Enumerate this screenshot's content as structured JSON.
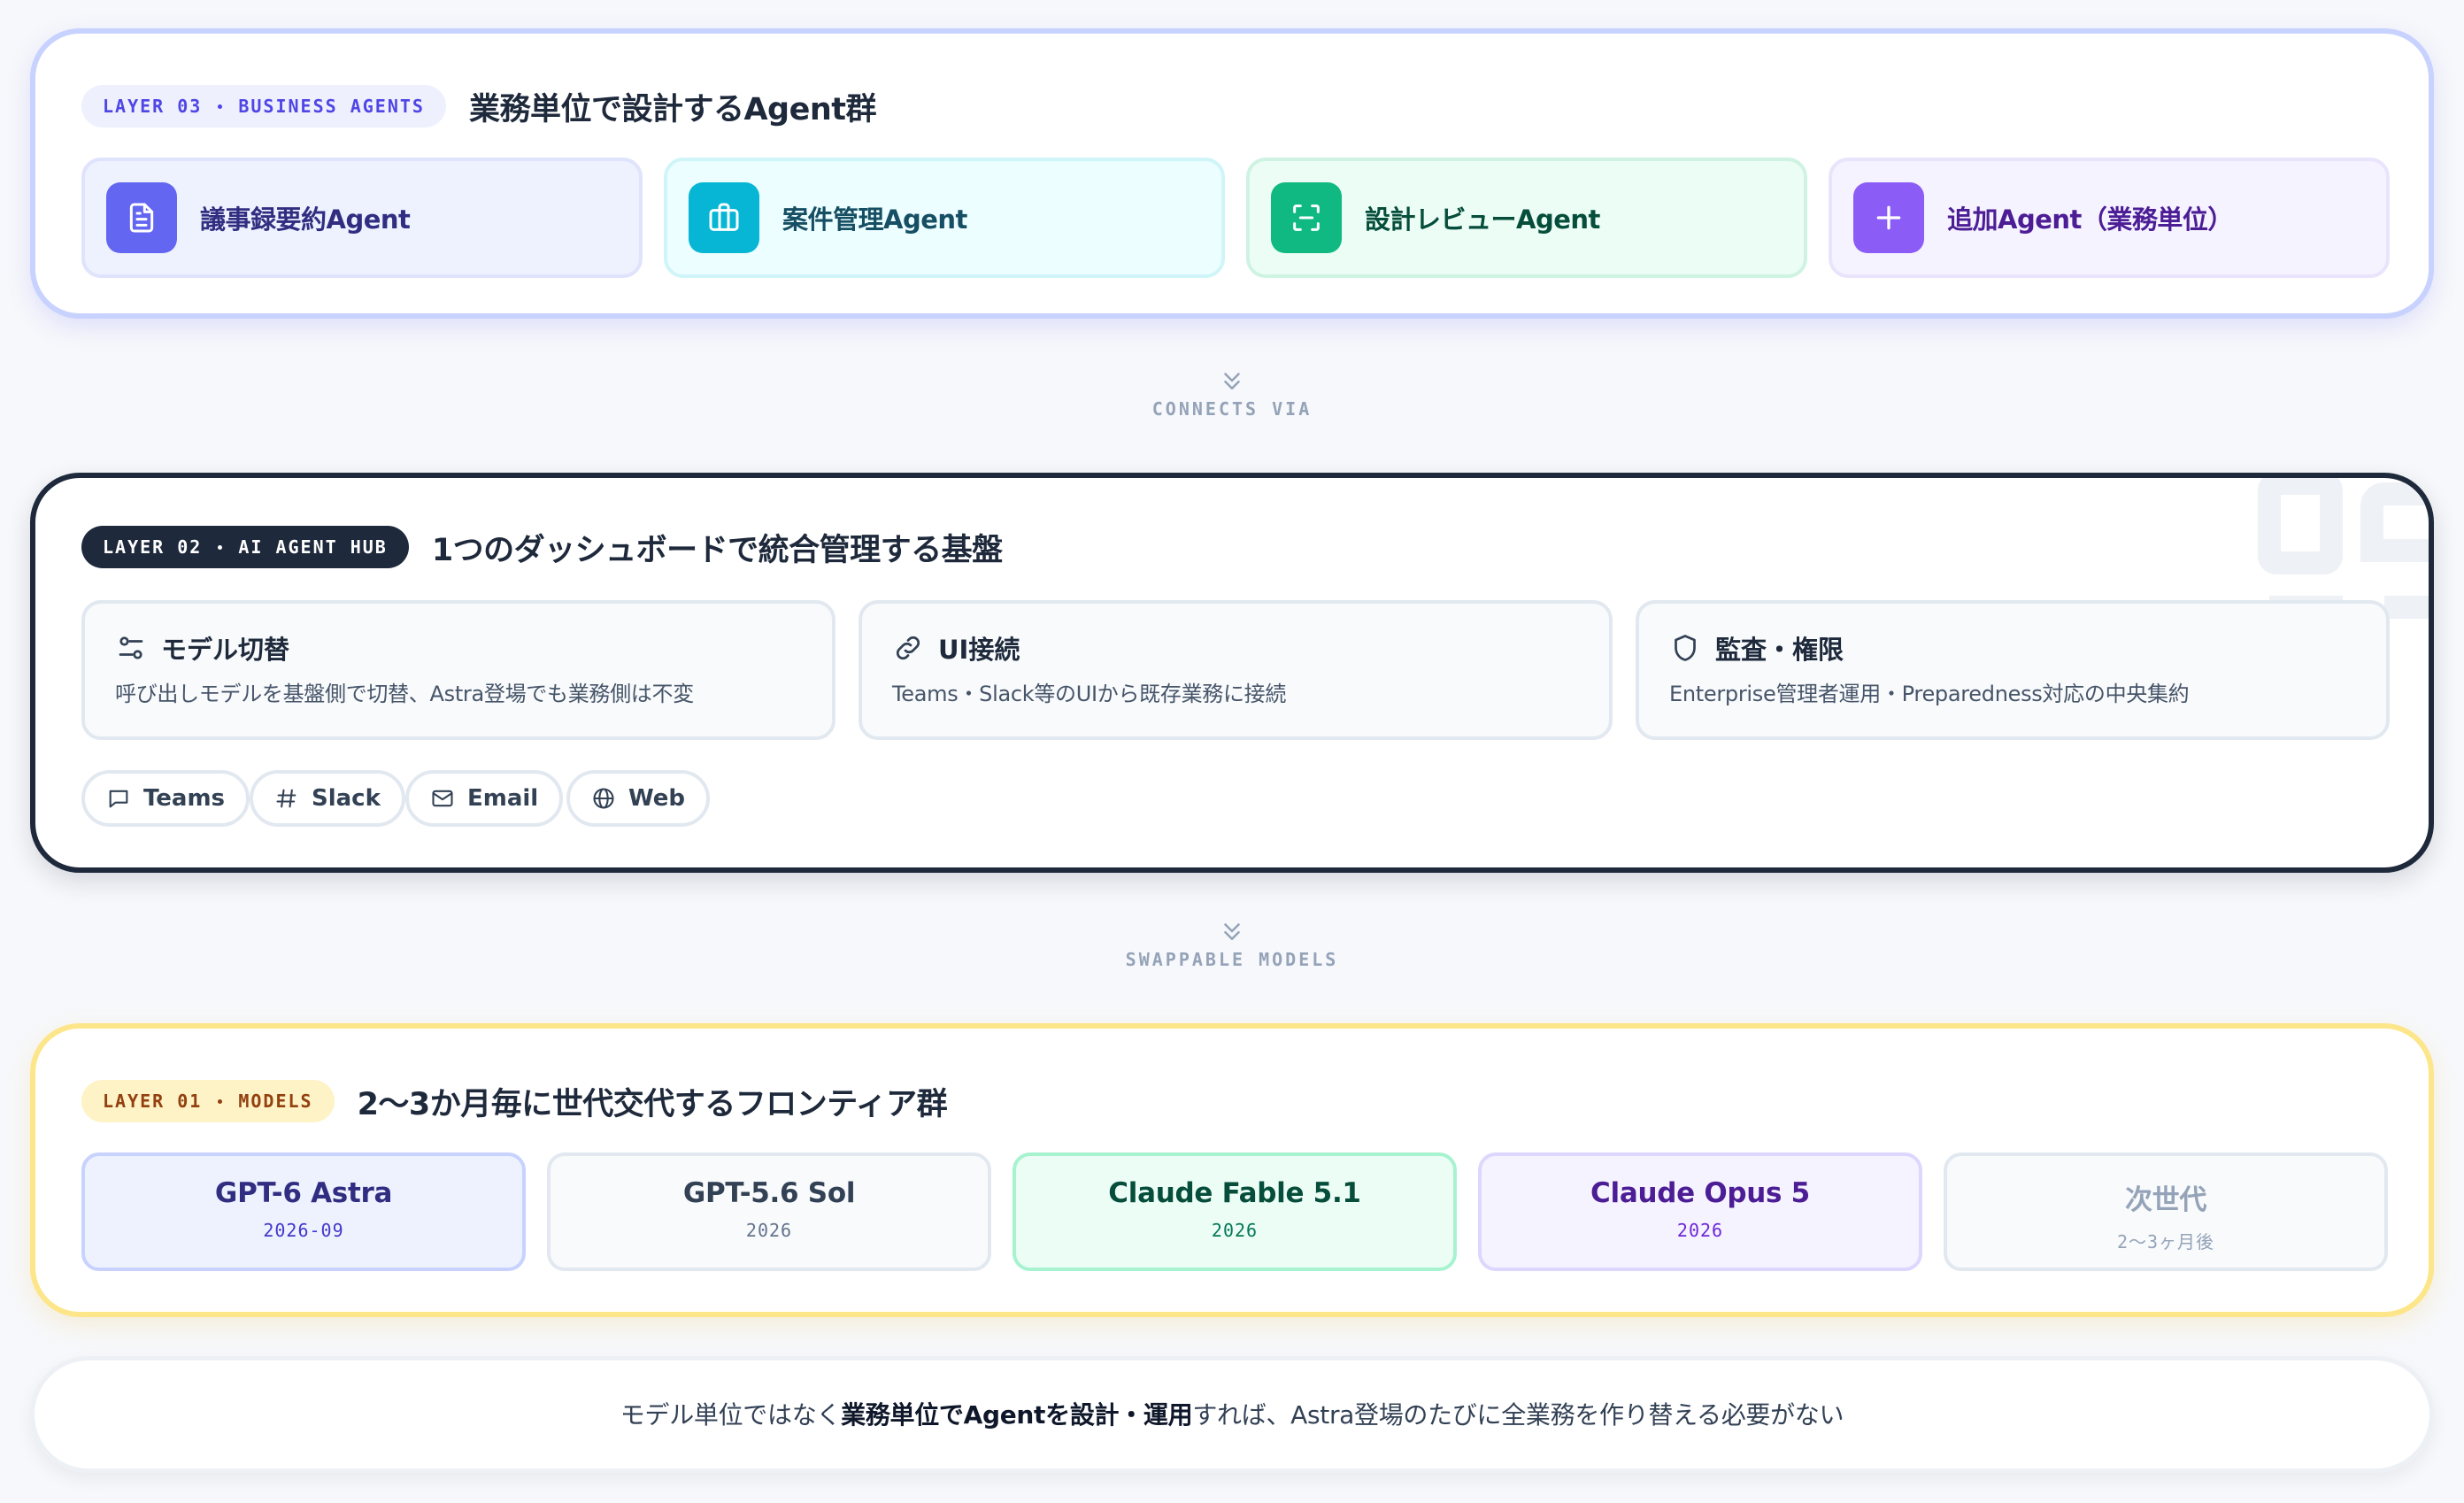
{
  "layer3": {
    "badge_prefix": "LAYER 03",
    "badge_suffix": "BUSINESS AGENTS",
    "title": "業務単位で設計するAgent群",
    "agents": [
      {
        "label": "議事録要約Agent",
        "icon": "document-icon",
        "color": "#6366f1"
      },
      {
        "label": "案件管理Agent",
        "icon": "briefcase-icon",
        "color": "#06b6d4"
      },
      {
        "label": "設計レビューAgent",
        "icon": "scan-icon",
        "color": "#10b981"
      },
      {
        "label": "追加Agent（業務単位）",
        "icon": "plus-icon",
        "color": "#8b5cf6"
      }
    ]
  },
  "connector1": {
    "label": "CONNECTS VIA"
  },
  "layer2": {
    "badge_prefix": "LAYER 02",
    "badge_suffix": "AI AGENT HUB",
    "title": "1つのダッシュボードで統合管理する基盤",
    "features": [
      {
        "title": "モデル切替",
        "desc": "呼び出しモデルを基盤側で切替、Astra登場でも業務側は不変",
        "icon": "switch-icon"
      },
      {
        "title": "UI接続",
        "desc": "Teams・Slack等のUIから既存業務に接続",
        "icon": "link-icon"
      },
      {
        "title": "監査・権限",
        "desc": "Enterprise管理者運用・Preparedness対応の中央集約",
        "icon": "shield-icon"
      }
    ],
    "channels": [
      {
        "label": "Teams",
        "icon": "chat-icon"
      },
      {
        "label": "Slack",
        "icon": "hash-icon"
      },
      {
        "label": "Email",
        "icon": "mail-icon"
      },
      {
        "label": "Web",
        "icon": "globe-icon"
      }
    ]
  },
  "connector2": {
    "label": "SWAPPABLE MODELS"
  },
  "layer1": {
    "badge_prefix": "LAYER 01",
    "badge_suffix": "MODELS",
    "title": "2〜3か月毎に世代交代するフロンティア群",
    "models": [
      {
        "name": "GPT-6 Astra",
        "date": "2026-09"
      },
      {
        "name": "GPT-5.6 Sol",
        "date": "2026"
      },
      {
        "name": "Claude Fable 5.1",
        "date": "2026"
      },
      {
        "name": "Claude Opus 5",
        "date": "2026"
      },
      {
        "name": "次世代",
        "date": "2〜3ヶ月後"
      }
    ]
  },
  "footer": {
    "text_a": "モデル単位ではなく",
    "text_b": "業務単位でAgentを設計・運用",
    "text_c": "すれば、Astra登場のたびに全業務を作り替える必要がない"
  }
}
